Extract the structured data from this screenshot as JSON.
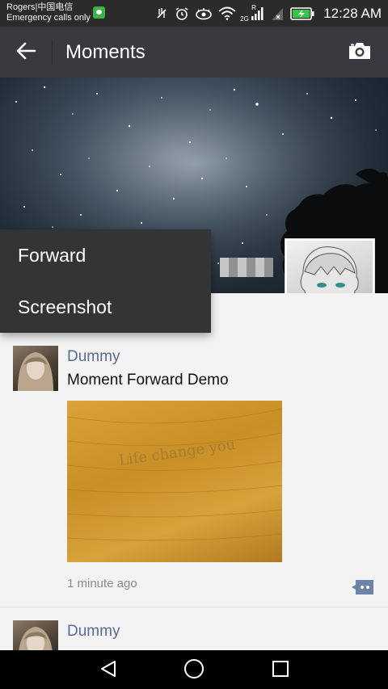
{
  "status_bar": {
    "carrier_line1": "Rogers|中国电信",
    "carrier_line2": "Emergency calls only",
    "network_label": "2G",
    "roaming_label": "R",
    "time": "12:28 AM"
  },
  "app_bar": {
    "title": "Moments"
  },
  "popup_menu": {
    "items": [
      {
        "label": "Forward"
      },
      {
        "label": "Screenshot"
      }
    ]
  },
  "posts": [
    {
      "author": "Dummy",
      "text": "Moment Forward Demo",
      "time": "1 minute ago",
      "photo_caption": "Life change you"
    },
    {
      "author": "Dummy"
    }
  ],
  "colors": {
    "app_bar": "#393a3f",
    "status_bar": "#2b2b2b",
    "author_link": "#576b95",
    "popup": "#333436"
  }
}
